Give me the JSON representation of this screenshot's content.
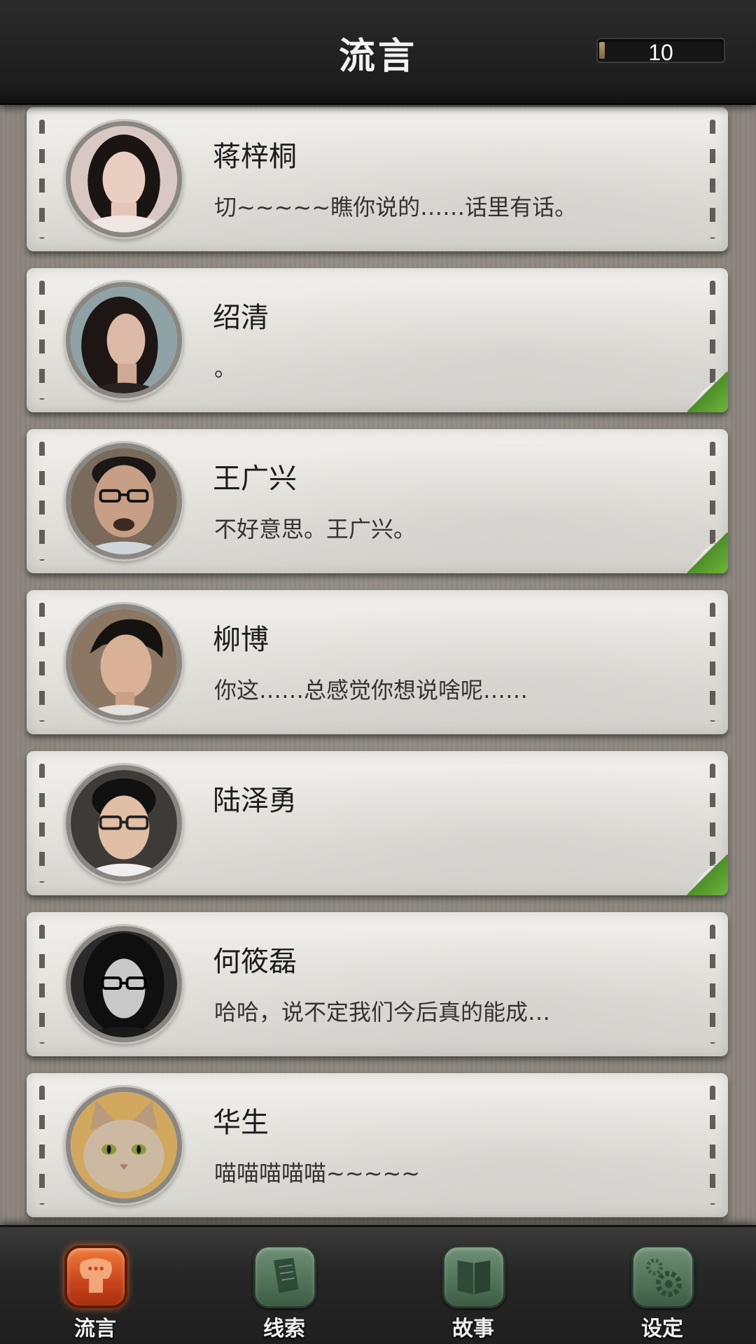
{
  "header": {
    "title": "流言",
    "counter": "10"
  },
  "contacts": [
    {
      "name": "蒋梓桐",
      "message": "切~~~~~瞧你说的……话里有话。",
      "avatar_icon": "woman-portrait-icon",
      "unread": false
    },
    {
      "name": "绍清",
      "message": "。",
      "avatar_icon": "woman-portrait-icon",
      "unread": true
    },
    {
      "name": "王广兴",
      "message": "不好意思。王广兴。",
      "avatar_icon": "man-with-glasses-portrait-icon",
      "unread": true
    },
    {
      "name": "柳博",
      "message": "你这……总感觉你想说啥呢……",
      "avatar_icon": "man-portrait-icon",
      "unread": false
    },
    {
      "name": "陆泽勇",
      "message": "",
      "avatar_icon": "man-with-glasses-portrait-icon",
      "unread": true
    },
    {
      "name": "何筱磊",
      "message": "哈哈，说不定我们今后真的能成…",
      "avatar_icon": "man-long-hair-glasses-portrait-icon",
      "unread": false
    },
    {
      "name": "华生",
      "message": "喵喵喵喵喵~~~~~",
      "avatar_icon": "cat-portrait-icon",
      "unread": false
    }
  ],
  "nav": {
    "items": [
      {
        "label": "流言",
        "icon": "chat-bubble-icon",
        "active": true
      },
      {
        "label": "线索",
        "icon": "document-icon",
        "active": false
      },
      {
        "label": "故事",
        "icon": "book-icon",
        "active": false
      },
      {
        "label": "设定",
        "icon": "gear-icon",
        "active": false
      }
    ]
  },
  "colors": {
    "accent_active": "#e0622a",
    "nav_inactive": "#4f6f56",
    "unread_curl": "#5fa234"
  }
}
